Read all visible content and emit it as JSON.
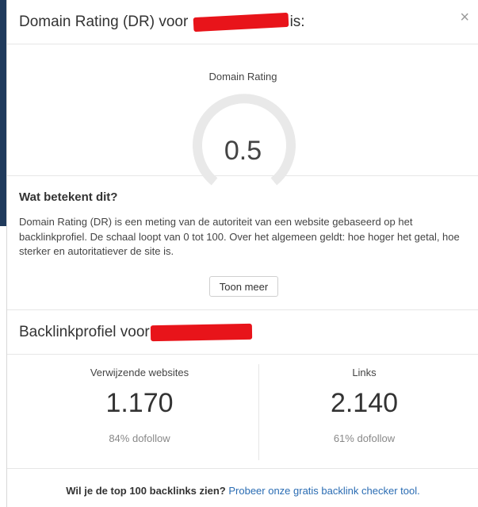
{
  "modal": {
    "title_prefix": "Domain Rating (DR) voor",
    "title_suffix": "is:",
    "close_icon": "×"
  },
  "dr": {
    "label": "Domain Rating",
    "value": "0.5",
    "max": 100,
    "gauge_track_color": "#e9e9e9"
  },
  "info": {
    "heading": "Wat betekent dit?",
    "text": "Domain Rating (DR) is een meting van de autoriteit van een website gebaseerd op het backlinkprofiel. De schaal loopt van 0 tot 100. Over het algemeen geldt: hoe hoger het getal, hoe sterker en autoritatiever de site is.",
    "more_button": "Toon meer"
  },
  "backlinks": {
    "title_prefix": "Backlinkprofiel voor",
    "referring": {
      "label": "Verwijzende websites",
      "value": "1.170",
      "sub": "84% dofollow"
    },
    "links": {
      "label": "Links",
      "value": "2.140",
      "sub": "61% dofollow"
    }
  },
  "footer": {
    "question": "Wil je de top 100 backlinks zien?",
    "link": "Probeer onze gratis backlink checker tool."
  },
  "colors": {
    "redaction": "#e8141a",
    "link": "#2a6cb3",
    "background_band": "#1f3a5c"
  }
}
